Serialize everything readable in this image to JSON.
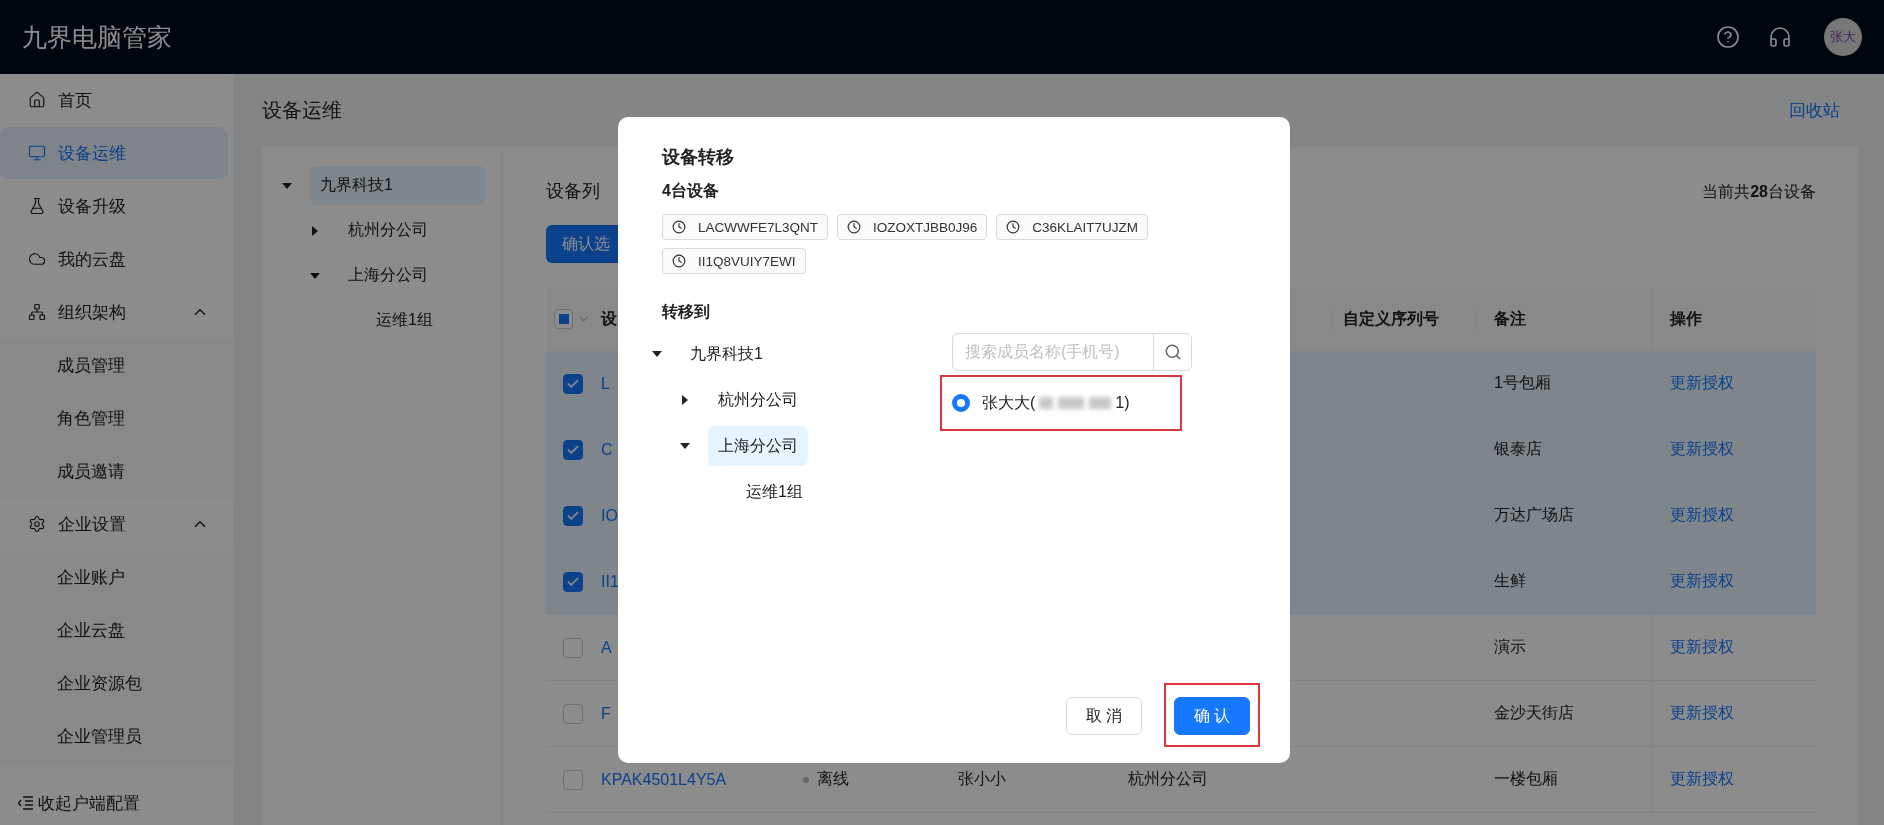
{
  "app": {
    "title": "九界电脑管家",
    "avatar": "张大"
  },
  "sidebar": {
    "items": [
      {
        "label": "首页",
        "selected": false
      },
      {
        "label": "设备运维",
        "selected": true
      },
      {
        "label": "设备升级",
        "selected": false
      },
      {
        "label": "我的云盘",
        "selected": false
      },
      {
        "label": "组织架构",
        "selected": false,
        "expanded": true,
        "children": [
          {
            "label": "成员管理",
            "selected": false
          },
          {
            "label": "角色管理",
            "selected": false
          },
          {
            "label": "成员邀请",
            "selected": false
          }
        ]
      },
      {
        "label": "企业设置",
        "selected": false,
        "expanded": true,
        "children": [
          {
            "label": "企业账户",
            "selected": false
          },
          {
            "label": "企业云盘",
            "selected": false
          },
          {
            "label": "企业资源包",
            "selected": false
          },
          {
            "label": "企业管理员",
            "selected": false
          }
        ]
      }
    ],
    "collapse": "收起",
    "partial_item": "户端配置"
  },
  "page": {
    "title": "设备运维",
    "recycle_link": "回收站"
  },
  "org_tree": [
    {
      "label": "九界科技1",
      "selected": true,
      "expanded": true,
      "children": [
        {
          "label": "杭州分公司",
          "selected": false,
          "expanded": false
        },
        {
          "label": "上海分公司",
          "selected": false,
          "expanded": true,
          "children": [
            {
              "label": "运维1组",
              "selected": false
            }
          ]
        }
      ]
    }
  ],
  "device_list": {
    "title": "设备列",
    "total": "当前共**28**台设备",
    "action_button": "确认选",
    "header_checkbox": {
      "indeterminate": true
    },
    "columns": [
      {
        "kind": "name",
        "label": "设"
      },
      {
        "kind": "status"
      },
      {
        "kind": "owner"
      },
      {
        "kind": "group"
      },
      {
        "kind": "serial",
        "label": "自定义序列号"
      },
      {
        "kind": "remark",
        "label": "备注"
      },
      {
        "kind": "action",
        "label": "操作"
      }
    ],
    "rows": [
      {
        "selected": true,
        "checked": true,
        "name": "L",
        "remark": "1号包厢",
        "action": "更新授权"
      },
      {
        "selected": true,
        "checked": true,
        "name": "C",
        "remark": "银泰店",
        "action": "更新授权"
      },
      {
        "selected": true,
        "checked": true,
        "name": "IO",
        "remark": "万达广场店",
        "action": "更新授权"
      },
      {
        "selected": true,
        "checked": true,
        "name": "II1",
        "remark": "生鲜",
        "action": "更新授权"
      },
      {
        "selected": false,
        "checked": false,
        "name": "A",
        "remark": "演示",
        "action": "更新授权"
      },
      {
        "selected": false,
        "checked": false,
        "name": "F",
        "remark": "金沙天街店",
        "action": "更新授权"
      },
      {
        "selected": false,
        "checked": false,
        "name": "KPAK4501L4Y5A",
        "status": "离线",
        "owner": "张小小",
        "group": "杭州分公司",
        "remark": "一楼包厢",
        "action": "更新授权"
      }
    ]
  },
  "dialog": {
    "title": "设备转移",
    "count_label": "4台设备",
    "devices": [
      "LACWWFE7L3QNT",
      "IOZOXTJBB0J96",
      "C36KLAIT7UJZM",
      "II1Q8VUIY7EWI"
    ],
    "target_label": "转移到",
    "tree": [
      {
        "label": "九界科技1",
        "selected": false,
        "expanded": true,
        "children": [
          {
            "label": "杭州分公司",
            "selected": false,
            "expanded": false
          },
          {
            "label": "上海分公司",
            "selected": true,
            "expanded": true,
            "children": [
              {
                "label": "运维1组",
                "selected": false
              }
            ]
          }
        ]
      }
    ],
    "search": {
      "placeholder": "搜索成员名称(手机号)"
    },
    "members": [
      {
        "name_start": "张大大(",
        "name_end": "1)",
        "selected": true,
        "highlighted": true
      }
    ],
    "buttons": [
      {
        "label": "取 消",
        "kind": "default",
        "highlighted": false
      },
      {
        "label": "确 认",
        "kind": "primary",
        "highlighted": true
      }
    ]
  }
}
